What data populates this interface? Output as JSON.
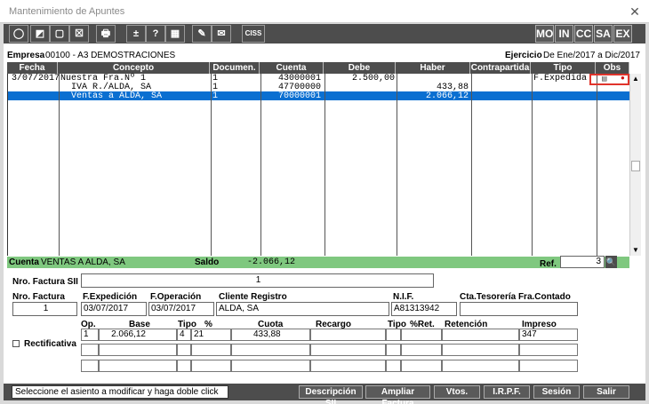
{
  "window": {
    "title": "Mantenimiento de Apuntes",
    "close": "✕"
  },
  "toolbar": {
    "left_buttons": [
      "◯",
      "◩",
      "▢",
      "☒",
      "🖶",
      "±",
      "?",
      "▦",
      "✎",
      "✉",
      "CISS"
    ],
    "right_buttons": [
      "MO",
      "IN",
      "CC",
      "SA",
      "EX"
    ]
  },
  "header": {
    "empresa_label": "Empresa",
    "empresa_value": "00100 - A3 DEMOSTRACIONES",
    "ejercicio_label": "Ejercicio",
    "ejercicio_value": "De Ene/2017 a Dic/2017"
  },
  "grid": {
    "columns": [
      "Fecha",
      "Concepto",
      "Documen.",
      "Cuenta",
      "Debe",
      "Haber",
      "Contrapartida",
      "Tipo",
      "Obs"
    ],
    "rows": [
      {
        "fecha": "3/07/2017",
        "concepto": "Nuestra Fra.Nº 1",
        "documento": "1",
        "cuenta": "43000001",
        "debe": "2.500,00",
        "haber": "",
        "contrapartida": "",
        "tipo": "F.Expedida"
      },
      {
        "fecha": "",
        "concepto": "  IVA R./ALDA, SA",
        "documento": "1",
        "cuenta": "47700000",
        "debe": "",
        "haber": "433,88",
        "contrapartida": "",
        "tipo": ""
      },
      {
        "fecha": "",
        "concepto": "  Ventas a ALDA, SA",
        "documento": "1",
        "cuenta": "70000001",
        "debe": "",
        "haber": "2.066,12",
        "contrapartida": "",
        "tipo": ""
      }
    ],
    "obs_icons": [
      "document-icon",
      "red-dot-icon"
    ]
  },
  "statusbar": {
    "cuenta_label": "Cuenta",
    "cuenta_value": "VENTAS A ALDA, SA",
    "saldo_label": "Saldo",
    "saldo_value": "-2.066,12",
    "ref_label": "Ref.",
    "ref_value": "3"
  },
  "form": {
    "nro_factura_sii_label": "Nro. Factura SII",
    "nro_factura_sii_value": "1",
    "nro_factura_label": "Nro. Factura",
    "nro_factura_value": "1",
    "f_expedicion_label": "F.Expedición",
    "f_expedicion_value": "03/07/2017",
    "f_operacion_label": "F.Operación",
    "f_operacion_value": "03/07/2017",
    "cliente_label": "Cliente Registro",
    "cliente_value": "ALDA, SA",
    "nif_label": "N.I.F.",
    "nif_value": "A81313942",
    "cta_tesoreria_label": "Cta.Tesorería Fra.Contado",
    "cta_tesoreria_value": "",
    "rectificativa_label": "Rectificativa",
    "tax_columns": [
      "Op.",
      "Base",
      "Tipo",
      "%",
      "Cuota",
      "Recargo",
      "Tipo",
      "%Ret.",
      "Retención",
      "Impreso"
    ],
    "tax_row": {
      "op": "1",
      "base": "2.066,12",
      "tipo": "4",
      "pct": "21",
      "cuota": "433,88",
      "recargo": "",
      "tipo2": "",
      "ret": "",
      "retencion": "",
      "impreso": "347"
    }
  },
  "bottom": {
    "hint": "Seleccione el asiento a modificar y haga doble click",
    "buttons": [
      "Descripción SII",
      "Ampliar Factura",
      "Vtos.",
      "I.R.P.F.",
      "Sesión",
      "Salir"
    ]
  }
}
